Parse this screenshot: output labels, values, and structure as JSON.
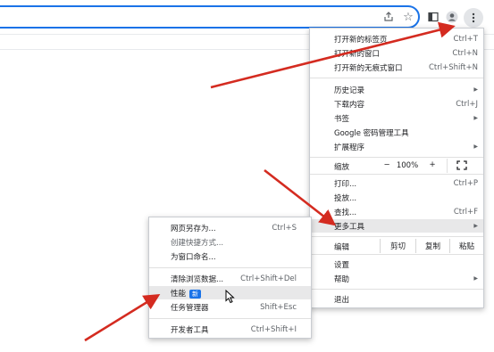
{
  "toolbar": {
    "icons": [
      "share-icon",
      "star-icon",
      "side-panel-icon",
      "profile-icon",
      "menu-icon"
    ]
  },
  "main_menu": {
    "new_tab": {
      "label": "打开新的标签页",
      "shortcut": "Ctrl+T"
    },
    "new_window": {
      "label": "打开新的窗口",
      "shortcut": "Ctrl+N"
    },
    "new_incognito": {
      "label": "打开新的无痕式窗口",
      "shortcut": "Ctrl+Shift+N"
    },
    "history": {
      "label": "历史记录"
    },
    "downloads": {
      "label": "下载内容",
      "shortcut": "Ctrl+J"
    },
    "bookmarks": {
      "label": "书签"
    },
    "passwords": {
      "label": "Google 密码管理工具"
    },
    "extensions": {
      "label": "扩展程序"
    },
    "zoom": {
      "label": "缩放",
      "minus": "−",
      "value": "100%",
      "plus": "+"
    },
    "print": {
      "label": "打印...",
      "shortcut": "Ctrl+P"
    },
    "cast": {
      "label": "投放..."
    },
    "find": {
      "label": "查找...",
      "shortcut": "Ctrl+F"
    },
    "more_tools": {
      "label": "更多工具"
    },
    "edit": {
      "label": "编辑",
      "cut": "剪切",
      "copy": "复制",
      "paste": "粘贴"
    },
    "settings": {
      "label": "设置"
    },
    "help": {
      "label": "帮助"
    },
    "exit": {
      "label": "退出"
    }
  },
  "sub_menu": {
    "save_page": {
      "label": "网页另存为...",
      "shortcut": "Ctrl+S"
    },
    "create_shortcut": {
      "label": "创建快捷方式..."
    },
    "name_window": {
      "label": "为窗口命名..."
    },
    "clear_data": {
      "label": "清除浏览数据...",
      "shortcut": "Ctrl+Shift+Del"
    },
    "performance": {
      "label": "性能",
      "badge": "新"
    },
    "task_manager": {
      "label": "任务管理器",
      "shortcut": "Shift+Esc"
    },
    "dev_tools": {
      "label": "开发者工具",
      "shortcut": "Ctrl+Shift+I"
    }
  },
  "colors": {
    "accent": "#1a73e8",
    "annotation_arrow": "#d42b20",
    "highlight": "#e8e8e9"
  }
}
